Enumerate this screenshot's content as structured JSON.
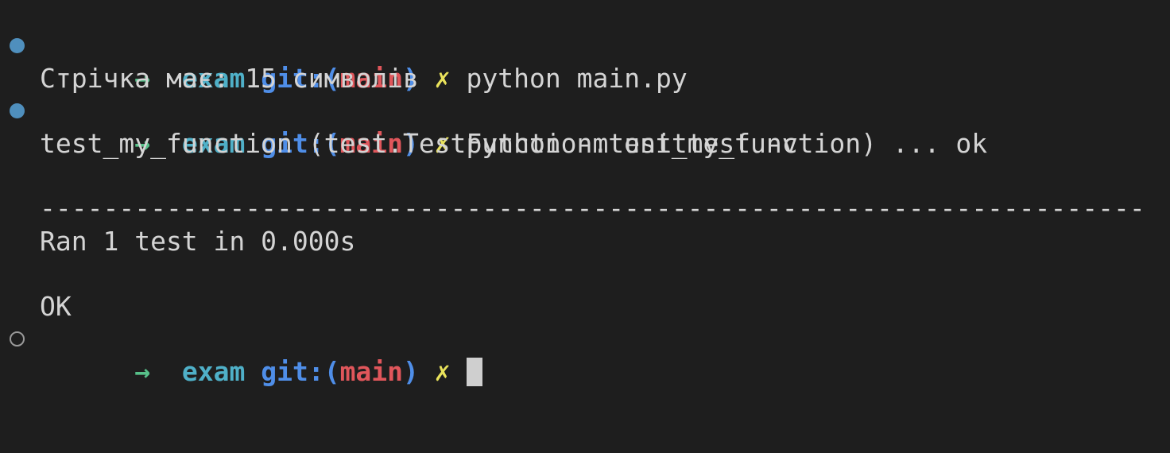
{
  "prompt": {
    "arrow": "→",
    "directory": "exam",
    "git_prefix": "git:",
    "paren_open": "(",
    "branch": "main",
    "paren_close": ")",
    "dirty_marker": "✗"
  },
  "lines": {
    "cmd1": "python main.py",
    "out1": "Стрічка має: 15 символів",
    "cmd2": "python -m unittest -v",
    "out2": "test_my_function (test.TestFunction.test_my_function) ... ok",
    "divider": "----------------------------------------------------------------------",
    "ran": "Ran 1 test in 0.000s",
    "ok": "OK"
  },
  "colors": {
    "background": "#1e1e1e",
    "text": "#d4d4d4",
    "arrow": "#57c089",
    "directory": "#4fb0c8",
    "git": "#4f8ee8",
    "branch": "#e0565b",
    "dirty": "#e9e25b",
    "dot_done": "#4f8fbd"
  }
}
